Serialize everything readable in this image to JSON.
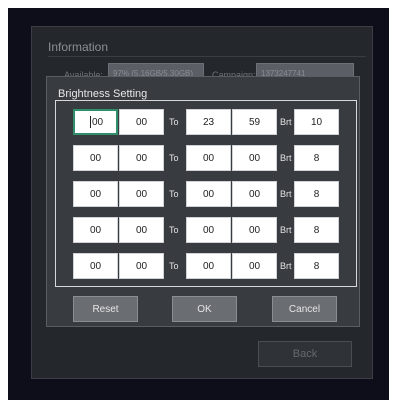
{
  "info": {
    "title": "Information",
    "available_label": "Available:",
    "available_value": "97% (5.16GB/5.30GB)",
    "campaign_label": "Campaign:",
    "campaign_value": "1373247741",
    "back_label": "Back"
  },
  "dialog": {
    "title": "Brightness Setting",
    "to_label": "To",
    "brt_label": "Brt",
    "rows": [
      {
        "start_h": "00",
        "start_m": "00",
        "end_h": "23",
        "end_m": "59",
        "brt": "10"
      },
      {
        "start_h": "00",
        "start_m": "00",
        "end_h": "00",
        "end_m": "00",
        "brt": "8"
      },
      {
        "start_h": "00",
        "start_m": "00",
        "end_h": "00",
        "end_m": "00",
        "brt": "8"
      },
      {
        "start_h": "00",
        "start_m": "00",
        "end_h": "00",
        "end_m": "00",
        "brt": "8"
      },
      {
        "start_h": "00",
        "start_m": "00",
        "end_h": "00",
        "end_m": "00",
        "brt": "8"
      }
    ],
    "reset_label": "Reset",
    "ok_label": "OK",
    "cancel_label": "Cancel"
  },
  "colors": {
    "accent_focus": "#2f8f6a",
    "dialog_bg": "#383b3f",
    "screen_bg": "#0d0e1a"
  }
}
